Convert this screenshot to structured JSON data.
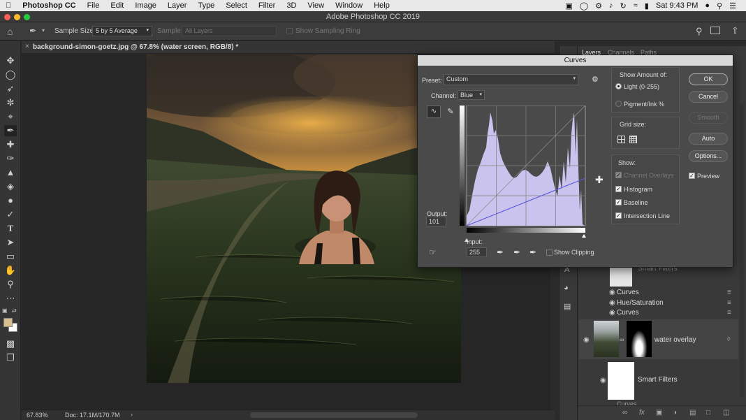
{
  "menubar": {
    "app_name": "Photoshop CC",
    "items": [
      "File",
      "Edit",
      "Image",
      "Layer",
      "Type",
      "Select",
      "Filter",
      "3D",
      "View",
      "Window",
      "Help"
    ],
    "clock": "Sat 9:43 PM"
  },
  "window": {
    "title": "Adobe Photoshop CC 2019"
  },
  "options": {
    "sample_size_label": "Sample Size:",
    "sample_size_value": "5 by 5 Average",
    "sample_label": "Sample:",
    "sample_value": "All Layers",
    "show_sampling_ring": "Show Sampling Ring"
  },
  "document": {
    "tab_title": "background-simon-goetz.jpg @ 67.8% (water screen, RGB/8) *",
    "zoom": "67.83%",
    "doc_size": "Doc: 17.1M/170.7M"
  },
  "panels": {
    "tabs": [
      "Layers",
      "Channels",
      "Paths"
    ],
    "layers": {
      "smart_filters_top": "Smart Filters",
      "filters": [
        "Curves",
        "Hue/Saturation",
        "Curves"
      ],
      "water_overlay": "water overlay",
      "smart_filters": "Smart Filters",
      "curves_partial": "Curves"
    }
  },
  "curves": {
    "title": "Curves",
    "preset_label": "Preset:",
    "preset_value": "Custom",
    "channel_label": "Channel:",
    "channel_value": "Blue",
    "output_label": "Output:",
    "output_value": "101",
    "input_label": "Input:",
    "input_value": "255",
    "show_clipping": "Show Clipping",
    "show_amount_label": "Show Amount of:",
    "light_option": "Light  (0-255)",
    "pigment_option": "Pigment/Ink %",
    "grid_size_label": "Grid size:",
    "show_label": "Show:",
    "channel_overlays": "Channel Overlays",
    "histogram": "Histogram",
    "baseline": "Baseline",
    "intersection_line": "Intersection Line",
    "ok": "OK",
    "cancel": "Cancel",
    "smooth": "Smooth",
    "auto": "Auto",
    "options": "Options...",
    "preview": "Preview",
    "checks": {
      "channel_overlays": true,
      "histogram": true,
      "baseline": true,
      "intersection_line": true,
      "preview": true,
      "show_clipping": false
    },
    "light_selected": true
  },
  "colors": {
    "histogram_fill": "#c9c3ee",
    "ui_bg": "#2b2b2b",
    "dialog_bg": "#4a4a4a",
    "curve_line": "#5a5ad8"
  }
}
